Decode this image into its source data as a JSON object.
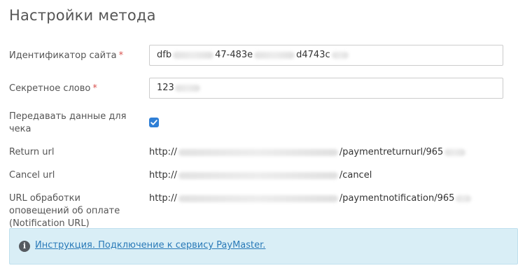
{
  "page": {
    "title": "Настройки метода"
  },
  "fields": {
    "site_id": {
      "label": "Идентификатор сайта",
      "required_mark": "*",
      "value_start": "dfb",
      "value_mid": "47-483e",
      "value_end": "d4743c"
    },
    "secret_word": {
      "label": "Секретное слово",
      "required_mark": "*",
      "value_start": "123"
    },
    "send_receipt": {
      "label": "Передавать данные для чека",
      "checked": true
    },
    "return_url": {
      "label": "Return url",
      "prefix": "http://",
      "suffix": "/paymentreturnurl/965"
    },
    "cancel_url": {
      "label": "Cancel url",
      "prefix": "http://",
      "suffix": "/cancel"
    },
    "notification_url": {
      "label": "URL обработки оповещений об оплате (Notification URL)",
      "prefix": "http://",
      "suffix": "/paymentnotification/965"
    }
  },
  "alert": {
    "icon": "info-icon",
    "link_text": "Инструкция. Подключение к сервису PayMaster."
  },
  "colors": {
    "checkbox": "#2f7fd6",
    "alert_bg": "#d9eef6",
    "link": "#2a7ab8",
    "required": "#d9534f"
  }
}
